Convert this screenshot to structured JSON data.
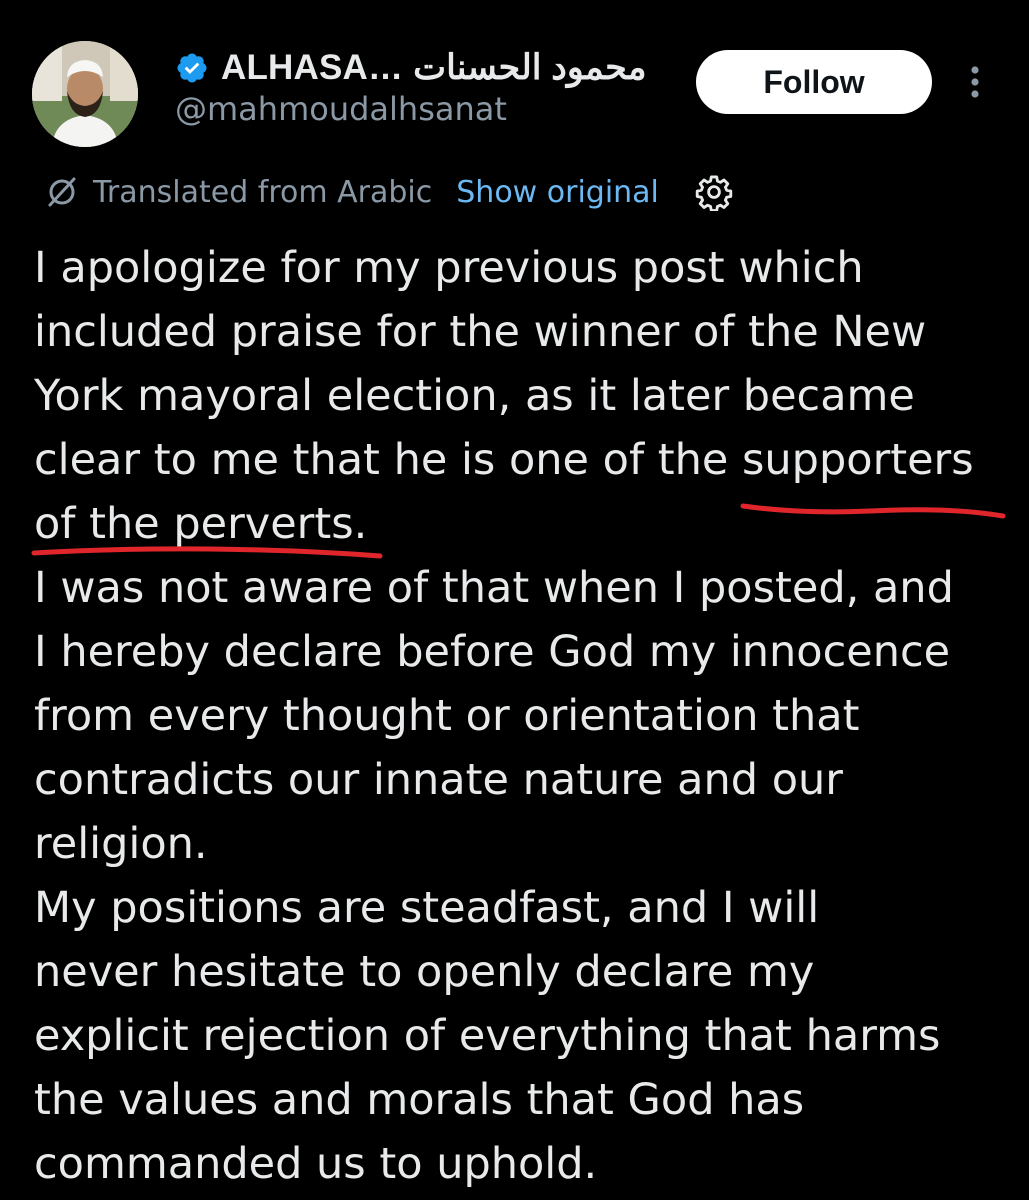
{
  "author": {
    "display_name": "ALHASA… محمود الحسنات",
    "handle": "@mahmoudalhsanat",
    "verified": true,
    "avatar_icon": "profile-photo"
  },
  "actions": {
    "follow_label": "Follow",
    "more_icon": "more-vertical-icon"
  },
  "translation": {
    "label": "Translated from Arabic",
    "show_original_label": "Show original",
    "settings_icon": "gear-icon"
  },
  "post": {
    "lines": [
      "I apologize for my previous post which",
      "included praise for the winner of the New",
      "York mayoral election, as it later became",
      "clear to me that he is one of the supporters",
      "of the perverts.",
      "I was not aware of that when I posted, and",
      "I hereby declare before God my innocence",
      "from every thought or orientation that",
      "contradicts our innate nature and our",
      "religion.",
      "My positions are steadfast, and I will",
      "never hesitate to openly declare my",
      "explicit rejection of everything that harms",
      "the values and morals that God has",
      "commanded us to uphold."
    ],
    "underline_color": "#e0262b"
  },
  "colors": {
    "background": "#000000",
    "text": "#e7e9ea",
    "secondary": "#8b98a5",
    "link": "#6cb8f2",
    "verified": "#1d9bf0"
  }
}
